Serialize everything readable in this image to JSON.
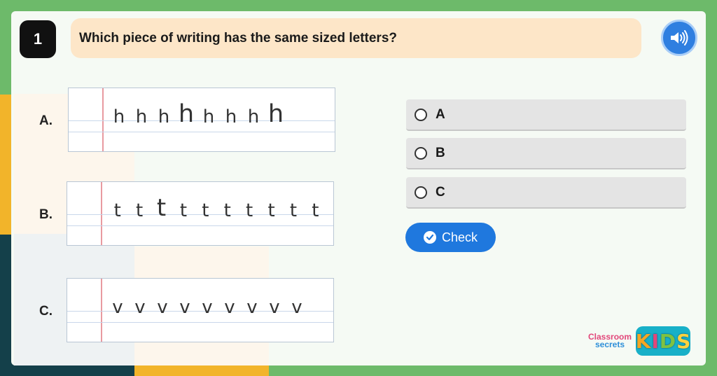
{
  "question": {
    "number": "1",
    "text": "Which piece of writing has the same sized letters?"
  },
  "options": [
    {
      "label": "A.",
      "letter": "h",
      "sizes": [
        1,
        1,
        1,
        1.35,
        1,
        1,
        1,
        1.35
      ]
    },
    {
      "label": "B.",
      "letter": "t",
      "sizes": [
        1,
        1,
        1.3,
        1,
        1,
        1,
        1,
        1,
        1,
        1
      ]
    },
    {
      "label": "C.",
      "letter": "v",
      "sizes": [
        1,
        1,
        1,
        1,
        1,
        1,
        1,
        1,
        1
      ]
    }
  ],
  "answers": [
    {
      "text": "A"
    },
    {
      "text": "B"
    },
    {
      "text": "C"
    }
  ],
  "check_label": "Check",
  "logo": {
    "word1": "Classroom",
    "word2": "secrets",
    "kids_letters": [
      "K",
      "I",
      "D",
      "S"
    ],
    "kids_colors": [
      "#f5a623",
      "#e2477a",
      "#7fc241",
      "#ffd23f"
    ]
  },
  "colors": {
    "background": "#6dba6a",
    "accent": "#1f78de",
    "question_bg": "#fde6c8"
  },
  "icons": {
    "audio": "speaker-icon",
    "check": "check-circle-icon",
    "radio": "radio-unselected-icon"
  }
}
